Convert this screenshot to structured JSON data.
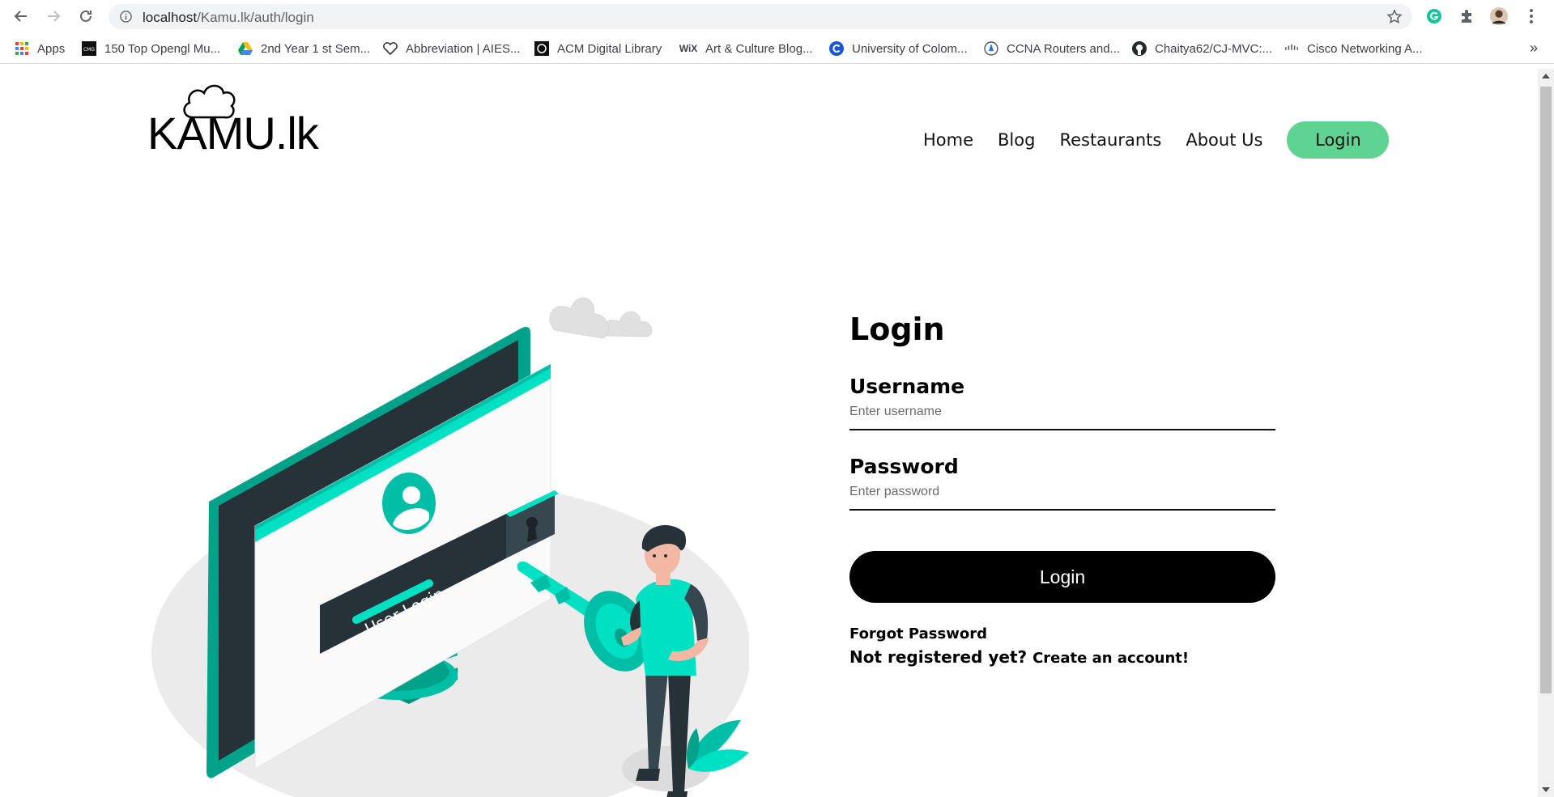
{
  "browser": {
    "url_host": "localhost",
    "url_path": "/Kamu.lk/auth/login",
    "bookmarks": [
      {
        "label": "Apps",
        "icon": "apps-grid-icon"
      },
      {
        "label": "150 Top Opengl Mu...",
        "icon": "cmg-icon"
      },
      {
        "label": "2nd Year 1 st Sem...",
        "icon": "google-drive-icon"
      },
      {
        "label": "Abbreviation | AIES...",
        "icon": "heart-outline-icon"
      },
      {
        "label": "ACM Digital Library",
        "icon": "acm-icon"
      },
      {
        "label": "Art & Culture Blog...",
        "icon": "wix-icon"
      },
      {
        "label": "University of Colom...",
        "icon": "c-logo-icon"
      },
      {
        "label": "CCNA Routers and...",
        "icon": "compass-icon"
      },
      {
        "label": "Chaitya62/CJ-MVC:...",
        "icon": "github-icon"
      },
      {
        "label": "Cisco Networking A...",
        "icon": "cisco-icon"
      }
    ],
    "more_label": "»"
  },
  "site": {
    "logo_text": "KAMU.lk",
    "nav": [
      "Home",
      "Blog",
      "Restaurants",
      "About Us"
    ],
    "nav_login": "Login"
  },
  "illustration": {
    "screen_text": "User Login"
  },
  "login_form": {
    "title": "Login",
    "username_label": "Username",
    "username_placeholder": "Enter username",
    "password_label": "Password",
    "password_placeholder": "Enter password",
    "submit_label": "Login",
    "forgot_password": "Forgot Password",
    "not_registered": "Not registered yet?",
    "create_account": "Create an account!"
  },
  "colors": {
    "accent_green": "#5fd391",
    "teal": "#00bfa6",
    "dark_slate": "#263238"
  }
}
